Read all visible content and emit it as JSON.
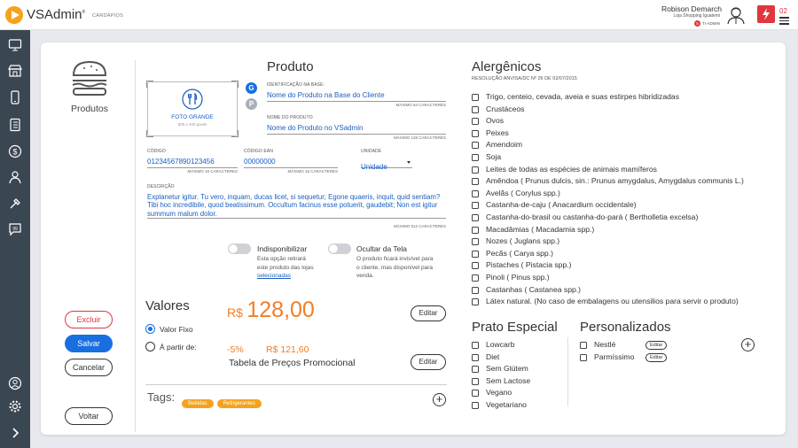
{
  "app": {
    "logo_text": "VSAdmin",
    "logo_mark": "®",
    "section": "CARDÁPIOS"
  },
  "user": {
    "name": "Robison Demarch",
    "store": "Loja Shopping Iguatemi",
    "role": "TI-ADMIN",
    "badge_count": "5",
    "notification_count": "02"
  },
  "module": {
    "label": "Produtos"
  },
  "product": {
    "title": "Produto",
    "image_label": "FOTO GRANDE",
    "image_size": "800 x 400 pixels",
    "badge_g": "G",
    "badge_p": "P",
    "base_id_label": "IDENTIFICAÇÃO NA BASE:",
    "base_id_value": "Nome do Produto na Base do Cliente",
    "base_id_hint": "MÁXIMO 64 CARACTERES",
    "name_label": "NOME DO PRODUTO",
    "name_value": "Nome do Produto no VSadmin",
    "name_hint": "MÁXIMO 128 CARACTERES",
    "code_label": "CÓDIGO",
    "code_value": "01234567890123456",
    "code_hint": "MÁXIMO 16 CARACTERES",
    "ean_label": "CÓDIGO EAN",
    "ean_value": "00000000",
    "ean_hint": "MÁXIMO 16 CARACTERES",
    "unit_label": "UNIDADE",
    "unit_value": "Unidade",
    "desc_label": "DESCRIÇÃO",
    "desc_value": "Explanetur igitur. Tu vero, inquam, ducas licet, si sequetur; Egone quaeris, inquit, quid sentiam? Tibi hoc incredibile, quod beatissimum. Occultum facinus esse potuerit, gaudebit; Non est igitur summum malum dolor.",
    "desc_hint": "MÁXIMO 512 CARACTERES",
    "unavailable_label": "Indisponibilizar",
    "unavailable_desc1": "Esta opção retirará",
    "unavailable_desc2": "este produto das lojas",
    "unavailable_link": "selecionadas",
    "hide_label": "Ocultar da Tela",
    "hide_desc1": "O produto ficará invisível para",
    "hide_desc2": "o cliente, mas disponível para",
    "hide_desc3": "venda."
  },
  "values": {
    "title": "Valores",
    "price": "R$ 128,00",
    "price_prefix": "R$",
    "price_amount": "128,00",
    "fixed_label": "Valor Fixo",
    "from_label": "À partir de:",
    "discount": "-5%",
    "promo_price": "R$ 121,60",
    "promo_table": "Tabela de Preços Promocional",
    "edit_label": "Editar"
  },
  "tags": {
    "title": "Tags:",
    "items": [
      "Bebidas",
      "Refrigerantes"
    ]
  },
  "actions": {
    "delete": "Excluir",
    "save": "Salvar",
    "cancel": "Cancelar",
    "back": "Voltar"
  },
  "allergens": {
    "title": "Alergênicos",
    "subtitle": "RESOLUÇÃO ANVISA/DC Nº 26 DE 02/07/2015",
    "items": [
      "Trigo, centeio, cevada, aveia e suas estirpes hibridizadas",
      "Crustáceos",
      "Ovos",
      "Peixes",
      "Amendoim",
      "Soja",
      "Leites de todas as espécies de animais mamíferos",
      "Amêndoa ( Prunus dulcis, sin.: Prunus amygdalus, Amygdalus communis L.)",
      "Avelãs ( Corylus spp.)",
      "Castanha-de-caju ( Anacardium occidentale)",
      "Castanha-do-brasil ou castanha-do-pará ( Bertholletia excelsa)",
      "Macadâmias ( Macadamia spp.)",
      "Nozes ( Juglans spp.)",
      "Pecãs ( Carya spp.)",
      "Pistaches ( Pistacia spp.)",
      "Pinoli ( Pinus spp.)",
      "Castanhas ( Castanea spp.)",
      "Látex natural. (No caso de embalagens ou utensilios para servir o produto)"
    ]
  },
  "special": {
    "title": "Prato Especial",
    "items": [
      "Lowcarb",
      "Diet",
      "Sem Glútem",
      "Sem Lactose",
      "Vegano",
      "Vegetariano"
    ]
  },
  "custom": {
    "title": "Personalizados",
    "items": [
      "Nestlé",
      "Parmíssimo"
    ],
    "edit_label": "Editar"
  },
  "colors": {
    "accent": "#f57c22",
    "blue": "#1a5fc1",
    "sidebar": "#3b4653",
    "danger": "#e0363d",
    "tag": "#f4a21d"
  }
}
